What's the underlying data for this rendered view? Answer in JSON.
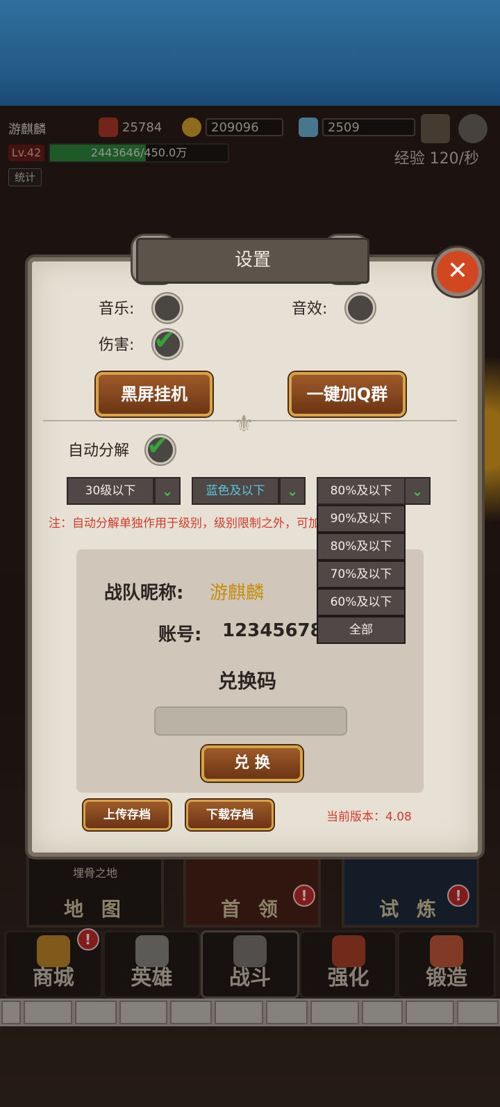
{
  "hud": {
    "player_name": "游麒麟",
    "power": "25784",
    "gold": "209096",
    "gems": "2509",
    "level": "Lv.42",
    "exp_text": "2443646/450.0万",
    "exp_fraction": 0.54,
    "stats_label": "统计",
    "exp_rate": "经验 120/秒"
  },
  "dialog": {
    "title": "设置",
    "close_label": "✕",
    "music_label": "音乐:",
    "sfx_label": "音效:",
    "damage_label": "伤害:",
    "blackscreen_button": "黑屏挂机",
    "join_group_button": "一键加Q群",
    "auto_decompose_label": "自动分解",
    "level_select": "30级以下",
    "quality_select": "蓝色及以下",
    "percent_select": "80%及以下",
    "percent_options": [
      "90%及以下",
      "80%及以下",
      "70%及以下",
      "60%及以下",
      "全部"
    ],
    "note": "注：自动分解单独作用于级别，级别限制之外，可加百分比",
    "team_name_label": "战队昵称:",
    "team_name_value": "游麒麟",
    "account_label": "账号:",
    "account_value": "12345678",
    "redeem_title": "兑换码",
    "redeem_placeholder": "",
    "redeem_button": "兑 换",
    "upload_button": "上传存档",
    "download_button": "下载存档",
    "version": "当前版本：4.08"
  },
  "areas": {
    "map_sub": "埋骨之地",
    "map": "地 图",
    "boss": "首 领",
    "trial": "试 炼"
  },
  "nav": {
    "shop": "商城",
    "heroes": "英雄",
    "battle": "战斗",
    "upgrade": "强化",
    "forge": "锻造"
  },
  "colors": {
    "accent_green": "#35a23a",
    "warning_red": "#d23c2c",
    "button_brown": "#6c3515",
    "button_gold_border": "#d6a446"
  }
}
